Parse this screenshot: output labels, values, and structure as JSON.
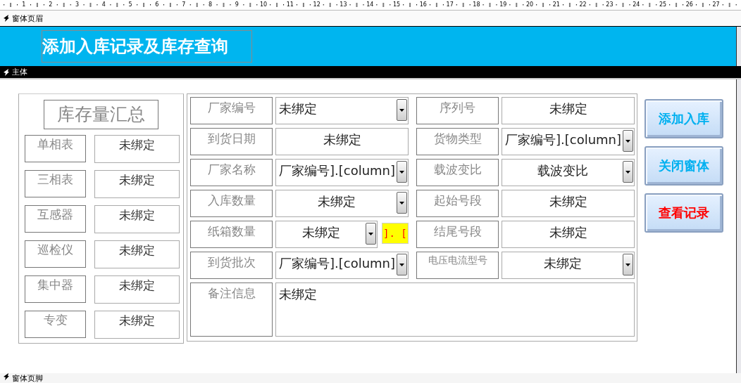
{
  "ruler": [
    "1",
    "2",
    "3",
    "4",
    "5",
    "6",
    "7",
    "8",
    "9",
    "10",
    "11",
    "12",
    "13",
    "14",
    "15",
    "16",
    "17",
    "18",
    "19",
    "20",
    "21",
    "22",
    "23",
    "24",
    "25",
    "26",
    "27"
  ],
  "sections": {
    "header": "窗体页眉",
    "detail": "主体",
    "footer": "窗体页脚"
  },
  "title": "添加入库记录及库存查询",
  "summary": {
    "title": "库存量汇总",
    "rows": [
      {
        "label": "单相表",
        "value": "未绑定"
      },
      {
        "label": "三相表",
        "value": "未绑定"
      },
      {
        "label": "互感器",
        "value": "未绑定"
      },
      {
        "label": "巡检仪",
        "value": "未绑定"
      },
      {
        "label": "集中器",
        "value": "未绑定"
      },
      {
        "label": "专变",
        "value": "未绑定"
      }
    ]
  },
  "form_rows": [
    [
      {
        "label": "厂家编号",
        "kind": "combo_left",
        "value": "未绑定"
      },
      {
        "label": "序列号",
        "kind": "text",
        "value": "未绑定"
      }
    ],
    [
      {
        "label": "到货日期",
        "kind": "text",
        "value": "未绑定"
      },
      {
        "label": "货物类型",
        "kind": "combo_left",
        "value": "厂家编号].[column]"
      }
    ],
    [
      {
        "label": "厂家名称",
        "kind": "combo_left",
        "value": "厂家编号].[column]"
      },
      {
        "label": "载波变比",
        "kind": "combo_center",
        "value": "载波变比"
      }
    ],
    [
      {
        "label": "入库数量",
        "kind": "combo_center",
        "value": "未绑定"
      },
      {
        "label": "起始号段",
        "kind": "text",
        "value": "未绑定"
      }
    ],
    [
      {
        "label": "纸箱数量",
        "kind": "combo_tag",
        "value": "未绑定",
        "tag": "]. ["
      },
      {
        "label": "结尾号段",
        "kind": "text",
        "value": "未绑定"
      }
    ],
    [
      {
        "label": "到货批次",
        "kind": "combo_left",
        "value": "厂家编号].[column]"
      },
      {
        "label": "电压电流型号",
        "kind": "combo_center",
        "value": "未绑定"
      }
    ],
    [
      {
        "label": "备注信息",
        "kind": "memo",
        "value": "未绑定"
      }
    ]
  ],
  "buttons": [
    {
      "label": "添加入库",
      "color": "#00b0f0"
    },
    {
      "label": "关闭窗体",
      "color": "#00b0f0"
    },
    {
      "label": "查看记录",
      "color": "#ff0000"
    }
  ]
}
